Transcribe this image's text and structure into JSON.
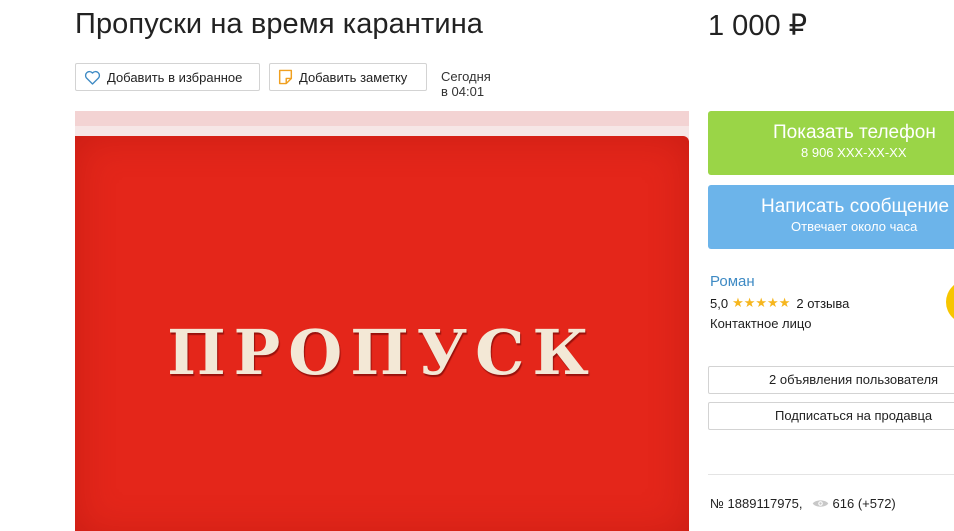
{
  "listing": {
    "title": "Пропуски на время карантина",
    "price": "1 000 ₽",
    "date": "Сегодня в 04:01",
    "photo_text": "ПРОПУСК",
    "id": "№ 1889117975,",
    "views": "616 (+572)"
  },
  "actions": {
    "favorite_label": "Добавить в избранное",
    "note_label": "Добавить заметку"
  },
  "contact": {
    "show_phone_label": "Показать телефон",
    "phone_masked": "8 906 XXX-XX-XX",
    "message_label": "Написать сообщение",
    "response_time": "Отвечает около часа"
  },
  "seller": {
    "name": "Роман",
    "rating": "5,0",
    "stars": "★★★★★",
    "reviews": "2 отзыва",
    "role": "Контактное лицо",
    "ads_label": "2 объявления пользователя",
    "subscribe_label": "Подписаться на продавца"
  },
  "colors": {
    "call_button": "#9ad547",
    "message_button": "#6cb4ea",
    "link": "#3e8ac4",
    "star": "#f6b61e",
    "cover_red": "#e4261a"
  },
  "icons": {
    "favorite": "heart-icon",
    "note": "note-icon",
    "views": "eye-icon"
  }
}
